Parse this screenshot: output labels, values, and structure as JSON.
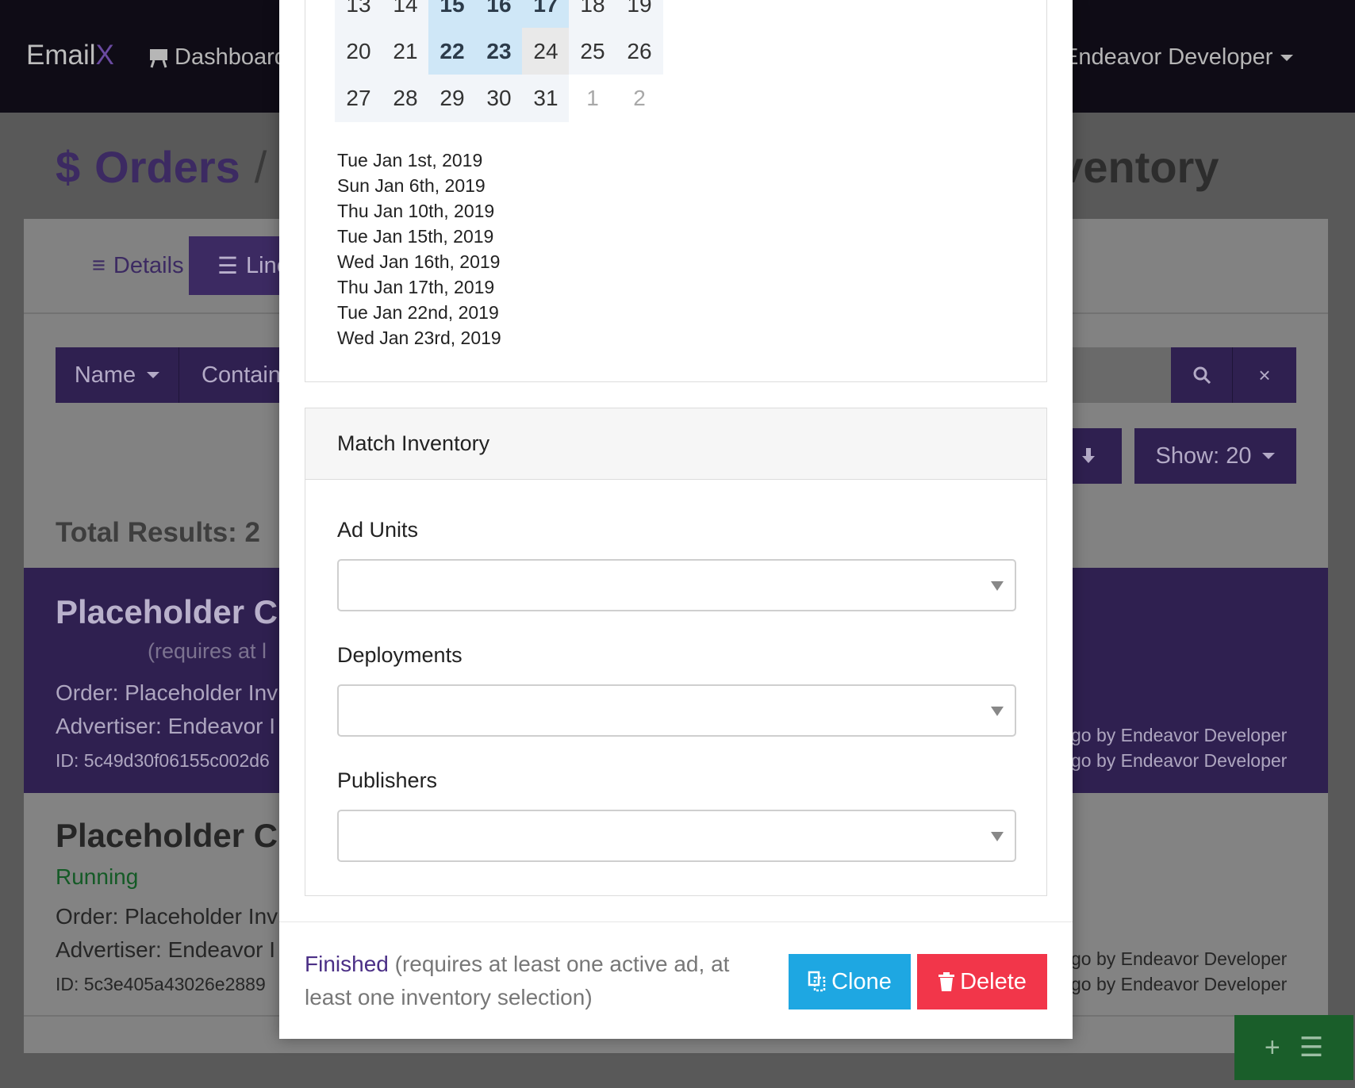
{
  "nav": {
    "brand_main": "Email",
    "brand_accent": "X",
    "dashboard_label": "Dashboard",
    "user_label": "Endeavor Developer"
  },
  "heading": {
    "icon": "$",
    "section": "Orders",
    "separator": "/",
    "right_text": "nventory"
  },
  "tabs": {
    "details": "Details",
    "line_items": "Line"
  },
  "filters": {
    "name_label": "Name",
    "contains_label": "Contain",
    "clear_glyph": "×",
    "show_label": "Show: 20"
  },
  "total_results": "Total Results: 2",
  "rows": [
    {
      "title": "Placeholder Cre",
      "status": "(requires at l",
      "order": "Order: Placeholder Inv",
      "advertiser": "Advertiser: Endeavor I",
      "id": "ID: 5c49d30f06155c002d6",
      "updated1": "go by Endeavor Developer",
      "updated2": "go by Endeavor Developer"
    },
    {
      "title": "Placeholder Cre",
      "status": "Running",
      "order": "Order: Placeholder Inv",
      "advertiser": "Advertiser: Endeavor I",
      "id": "ID: 5c3e405a43026e2889",
      "updated1": "go by Endeavor Developer",
      "updated2": "go by Endeavor Developer"
    }
  ],
  "calendar": {
    "weeks": [
      [
        {
          "d": "13",
          "s": ""
        },
        {
          "d": "14",
          "s": ""
        },
        {
          "d": "15",
          "s": "sel"
        },
        {
          "d": "16",
          "s": "sel"
        },
        {
          "d": "17",
          "s": "sel"
        },
        {
          "d": "18",
          "s": ""
        },
        {
          "d": "19",
          "s": ""
        }
      ],
      [
        {
          "d": "20",
          "s": ""
        },
        {
          "d": "21",
          "s": ""
        },
        {
          "d": "22",
          "s": "sel"
        },
        {
          "d": "23",
          "s": "sel"
        },
        {
          "d": "24",
          "s": "today"
        },
        {
          "d": "25",
          "s": ""
        },
        {
          "d": "26",
          "s": ""
        }
      ],
      [
        {
          "d": "27",
          "s": ""
        },
        {
          "d": "28",
          "s": ""
        },
        {
          "d": "29",
          "s": ""
        },
        {
          "d": "30",
          "s": ""
        },
        {
          "d": "31",
          "s": ""
        },
        {
          "d": "1",
          "s": "out"
        },
        {
          "d": "2",
          "s": "out"
        }
      ]
    ],
    "selected_dates": [
      "Tue Jan 1st, 2019",
      "Sun Jan 6th, 2019",
      "Thu Jan 10th, 2019",
      "Tue Jan 15th, 2019",
      "Wed Jan 16th, 2019",
      "Thu Jan 17th, 2019",
      "Tue Jan 22nd, 2019",
      "Wed Jan 23rd, 2019"
    ]
  },
  "match_inventory": {
    "title": "Match Inventory",
    "ad_units_label": "Ad Units",
    "deployments_label": "Deployments",
    "publishers_label": "Publishers"
  },
  "footer": {
    "status_word": "Finished",
    "status_detail": " (requires at least one active ad, at least one inventory selection)",
    "clone_label": "Clone",
    "delete_label": "Delete"
  }
}
